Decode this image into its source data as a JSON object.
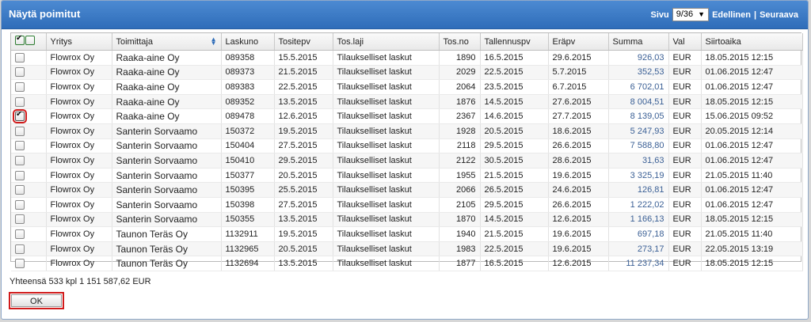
{
  "dialog": {
    "title": "Näytä poimitut",
    "pager": {
      "label": "Sivu",
      "page": "9/36",
      "prev": "Edellinen",
      "separator": "|",
      "next": "Seuraava"
    }
  },
  "table": {
    "columns": [
      "Yritys",
      "Toimittaja",
      "Laskuno",
      "Tositepv",
      "Tos.laji",
      "Tos.no",
      "Tallennuspv",
      "Eräpv",
      "Summa",
      "Val",
      "Siirtoaika"
    ],
    "sorted_column": "Toimittaja",
    "rows": [
      {
        "checked": false,
        "cells": [
          "Flowrox Oy",
          "Raaka-aine Oy",
          "089358",
          "15.5.2015",
          "Tilaukselliset laskut",
          "1890",
          "16.5.2015",
          "29.6.2015",
          "926,03",
          "EUR",
          "18.05.2015 12:15"
        ]
      },
      {
        "checked": false,
        "cells": [
          "Flowrox Oy",
          "Raaka-aine Oy",
          "089373",
          "21.5.2015",
          "Tilaukselliset laskut",
          "2029",
          "22.5.2015",
          "5.7.2015",
          "352,53",
          "EUR",
          "01.06.2015 12:47"
        ]
      },
      {
        "checked": false,
        "cells": [
          "Flowrox Oy",
          "Raaka-aine Oy",
          "089383",
          "22.5.2015",
          "Tilaukselliset laskut",
          "2064",
          "23.5.2015",
          "6.7.2015",
          "6 702,01",
          "EUR",
          "01.06.2015 12:47"
        ]
      },
      {
        "checked": false,
        "cells": [
          "Flowrox Oy",
          "Raaka-aine Oy",
          "089352",
          "13.5.2015",
          "Tilaukselliset laskut",
          "1876",
          "14.5.2015",
          "27.6.2015",
          "8 004,51",
          "EUR",
          "18.05.2015 12:15"
        ]
      },
      {
        "checked": true,
        "cells": [
          "Flowrox Oy",
          "Raaka-aine Oy",
          "089478",
          "12.6.2015",
          "Tilaukselliset laskut",
          "2367",
          "14.6.2015",
          "27.7.2015",
          "8 139,05",
          "EUR",
          "15.06.2015 09:52"
        ]
      },
      {
        "checked": false,
        "cells": [
          "Flowrox Oy",
          "Santerin Sorvaamo",
          "150372",
          "19.5.2015",
          "Tilaukselliset laskut",
          "1928",
          "20.5.2015",
          "18.6.2015",
          "5 247,93",
          "EUR",
          "20.05.2015 12:14"
        ]
      },
      {
        "checked": false,
        "cells": [
          "Flowrox Oy",
          "Santerin Sorvaamo",
          "150404",
          "27.5.2015",
          "Tilaukselliset laskut",
          "2118",
          "29.5.2015",
          "26.6.2015",
          "7 588,80",
          "EUR",
          "01.06.2015 12:47"
        ]
      },
      {
        "checked": false,
        "cells": [
          "Flowrox Oy",
          "Santerin Sorvaamo",
          "150410",
          "29.5.2015",
          "Tilaukselliset laskut",
          "2122",
          "30.5.2015",
          "28.6.2015",
          "31,63",
          "EUR",
          "01.06.2015 12:47"
        ]
      },
      {
        "checked": false,
        "cells": [
          "Flowrox Oy",
          "Santerin Sorvaamo",
          "150377",
          "20.5.2015",
          "Tilaukselliset laskut",
          "1955",
          "21.5.2015",
          "19.6.2015",
          "3 325,19",
          "EUR",
          "21.05.2015 11:40"
        ]
      },
      {
        "checked": false,
        "cells": [
          "Flowrox Oy",
          "Santerin Sorvaamo",
          "150395",
          "25.5.2015",
          "Tilaukselliset laskut",
          "2066",
          "26.5.2015",
          "24.6.2015",
          "126,81",
          "EUR",
          "01.06.2015 12:47"
        ]
      },
      {
        "checked": false,
        "cells": [
          "Flowrox Oy",
          "Santerin Sorvaamo",
          "150398",
          "27.5.2015",
          "Tilaukselliset laskut",
          "2105",
          "29.5.2015",
          "26.6.2015",
          "1 222,02",
          "EUR",
          "01.06.2015 12:47"
        ]
      },
      {
        "checked": false,
        "cells": [
          "Flowrox Oy",
          "Santerin Sorvaamo",
          "150355",
          "13.5.2015",
          "Tilaukselliset laskut",
          "1870",
          "14.5.2015",
          "12.6.2015",
          "1 166,13",
          "EUR",
          "18.05.2015 12:15"
        ]
      },
      {
        "checked": false,
        "cells": [
          "Flowrox Oy",
          "Taunon Teräs Oy",
          "1132911",
          "19.5.2015",
          "Tilaukselliset laskut",
          "1940",
          "21.5.2015",
          "19.6.2015",
          "697,18",
          "EUR",
          "21.05.2015 11:40"
        ]
      },
      {
        "checked": false,
        "cells": [
          "Flowrox Oy",
          "Taunon Teräs Oy",
          "1132965",
          "20.5.2015",
          "Tilaukselliset laskut",
          "1983",
          "22.5.2015",
          "19.6.2015",
          "273,17",
          "EUR",
          "22.05.2015 13:19"
        ]
      },
      {
        "checked": false,
        "cells": [
          "Flowrox Oy",
          "Taunon Teräs Oy",
          "1132694",
          "13.5.2015",
          "Tilaukselliset laskut",
          "1877",
          "16.5.2015",
          "12.6.2015",
          "11 237,34",
          "EUR",
          "18.05.2015 12:15"
        ]
      }
    ]
  },
  "summary": "Yhteensä 533 kpl 1 151 587,62 EUR",
  "ok_label": "OK",
  "colors": {
    "titlebar": "#2f6db9",
    "amount": "#3a5f95",
    "highlight": "#d11b1b"
  },
  "icons": {
    "sort": "sort-arrows-icon",
    "dropdown": "dropdown-arrow-icon"
  }
}
